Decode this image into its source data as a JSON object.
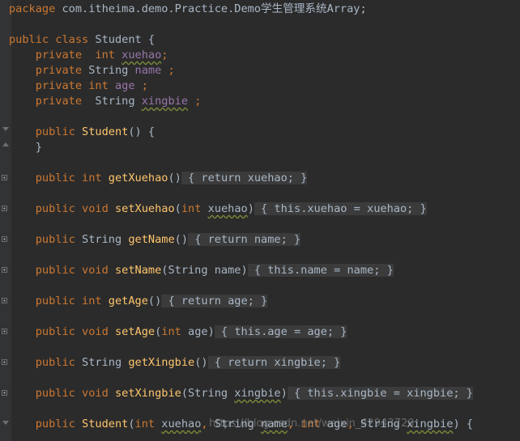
{
  "code_lines": [
    {
      "parts": [
        [
          "kw",
          "package"
        ],
        [
          "t",
          " com.itheima.demo.Practice.Demo学生管理系统Array;"
        ]
      ]
    },
    {
      "parts": []
    },
    {
      "parts": [
        [
          "kw",
          "public class"
        ],
        [
          "t",
          " Student {"
        ]
      ]
    },
    {
      "parts": [
        [
          "t",
          "    "
        ],
        [
          "kw",
          "private"
        ],
        [
          "t",
          "  "
        ],
        [
          "kw",
          "int"
        ],
        [
          "t",
          " "
        ],
        [
          "fldsq",
          "xuehao"
        ],
        [
          "kw",
          ";"
        ]
      ]
    },
    {
      "parts": [
        [
          "t",
          "    "
        ],
        [
          "kw",
          "private"
        ],
        [
          "t",
          " String "
        ],
        [
          "fld",
          "name"
        ],
        [
          "t",
          " "
        ],
        [
          "kw",
          ";"
        ]
      ]
    },
    {
      "parts": [
        [
          "t",
          "    "
        ],
        [
          "kw",
          "private"
        ],
        [
          "t",
          " "
        ],
        [
          "kw",
          "int"
        ],
        [
          "t",
          " "
        ],
        [
          "fld",
          "age"
        ],
        [
          "t",
          " "
        ],
        [
          "kw",
          ";"
        ]
      ]
    },
    {
      "parts": [
        [
          "t",
          "    "
        ],
        [
          "kw",
          "private"
        ],
        [
          "t",
          "  String "
        ],
        [
          "fldsq",
          "xingbie"
        ],
        [
          "t",
          " "
        ],
        [
          "kw",
          ";"
        ]
      ]
    },
    {
      "parts": []
    },
    {
      "parts": [
        [
          "t",
          "    "
        ],
        [
          "kw",
          "public"
        ],
        [
          "t",
          " "
        ],
        [
          "fn",
          "Student"
        ],
        [
          "t",
          "() {"
        ]
      ]
    },
    {
      "parts": [
        [
          "t",
          "    }"
        ]
      ]
    },
    {
      "parts": []
    },
    {
      "parts": [
        [
          "t",
          "    "
        ],
        [
          "kw",
          "public int"
        ],
        [
          "t",
          " "
        ],
        [
          "fn",
          "getXuehao"
        ],
        [
          "t",
          "()"
        ],
        [
          "fb",
          " { "
        ],
        [
          "fbkw",
          "return"
        ],
        [
          "fb",
          " "
        ],
        [
          "fbfld",
          "xuehao"
        ],
        [
          "fbkw",
          ";"
        ],
        [
          "fb",
          " }"
        ]
      ]
    },
    {
      "parts": []
    },
    {
      "parts": [
        [
          "t",
          "    "
        ],
        [
          "kw",
          "public void"
        ],
        [
          "t",
          " "
        ],
        [
          "fn",
          "setXuehao"
        ],
        [
          "t",
          "("
        ],
        [
          "kw",
          "int"
        ],
        [
          "t",
          " "
        ],
        [
          "sq",
          "xuehao"
        ],
        [
          "t",
          ")"
        ],
        [
          "fb",
          " { "
        ],
        [
          "fbkw",
          "this"
        ],
        [
          "fbkw",
          "."
        ],
        [
          "fbfld",
          "xuehao"
        ],
        [
          "fb",
          " = xuehao"
        ],
        [
          "fbkw",
          ";"
        ],
        [
          "fb",
          " }"
        ]
      ]
    },
    {
      "parts": []
    },
    {
      "parts": [
        [
          "t",
          "    "
        ],
        [
          "kw",
          "public"
        ],
        [
          "t",
          " String "
        ],
        [
          "fn",
          "getName"
        ],
        [
          "t",
          "()"
        ],
        [
          "fb",
          " { "
        ],
        [
          "fbkw",
          "return"
        ],
        [
          "fb",
          " "
        ],
        [
          "fbfld",
          "name"
        ],
        [
          "fbkw",
          ";"
        ],
        [
          "fb",
          " }"
        ]
      ]
    },
    {
      "parts": []
    },
    {
      "parts": [
        [
          "t",
          "    "
        ],
        [
          "kw",
          "public void"
        ],
        [
          "t",
          " "
        ],
        [
          "fn",
          "setName"
        ],
        [
          "t",
          "(String name)"
        ],
        [
          "fb",
          " { "
        ],
        [
          "fbkw",
          "this"
        ],
        [
          "fbkw",
          "."
        ],
        [
          "fbfld",
          "name"
        ],
        [
          "fb",
          " = name"
        ],
        [
          "fbkw",
          ";"
        ],
        [
          "fb",
          " }"
        ]
      ]
    },
    {
      "parts": []
    },
    {
      "parts": [
        [
          "t",
          "    "
        ],
        [
          "kw",
          "public int"
        ],
        [
          "t",
          " "
        ],
        [
          "fn",
          "getAge"
        ],
        [
          "t",
          "()"
        ],
        [
          "fb",
          " { "
        ],
        [
          "fbkw",
          "return"
        ],
        [
          "fb",
          " "
        ],
        [
          "fbfld",
          "age"
        ],
        [
          "fbkw",
          ";"
        ],
        [
          "fb",
          " }"
        ]
      ]
    },
    {
      "parts": []
    },
    {
      "parts": [
        [
          "t",
          "    "
        ],
        [
          "kw",
          "public void"
        ],
        [
          "t",
          " "
        ],
        [
          "fn",
          "setAge"
        ],
        [
          "t",
          "("
        ],
        [
          "kw",
          "int"
        ],
        [
          "t",
          " age)"
        ],
        [
          "fb",
          " { "
        ],
        [
          "fbkw",
          "this"
        ],
        [
          "fbkw",
          "."
        ],
        [
          "fbfld",
          "age"
        ],
        [
          "fb",
          " = age"
        ],
        [
          "fbkw",
          ";"
        ],
        [
          "fb",
          " }"
        ]
      ]
    },
    {
      "parts": []
    },
    {
      "parts": [
        [
          "t",
          "    "
        ],
        [
          "kw",
          "public"
        ],
        [
          "t",
          " String "
        ],
        [
          "fn",
          "getXingbie"
        ],
        [
          "t",
          "()"
        ],
        [
          "fb",
          " { "
        ],
        [
          "fbkw",
          "return"
        ],
        [
          "fb",
          " xingbie"
        ],
        [
          "fbkw",
          ";"
        ],
        [
          "fb",
          " }"
        ]
      ]
    },
    {
      "parts": []
    },
    {
      "parts": [
        [
          "t",
          "    "
        ],
        [
          "kw",
          "public void"
        ],
        [
          "t",
          " "
        ],
        [
          "fn",
          "setXingbie"
        ],
        [
          "t",
          "(String "
        ],
        [
          "sq",
          "xingbie"
        ],
        [
          "t",
          ")"
        ],
        [
          "fb",
          " { "
        ],
        [
          "fbkw",
          "this"
        ],
        [
          "fbkw",
          "."
        ],
        [
          "fbfld",
          "xingbie"
        ],
        [
          "fb",
          " = xingbie"
        ],
        [
          "fbkw",
          ";"
        ],
        [
          "fb",
          " }"
        ]
      ]
    },
    {
      "parts": []
    },
    {
      "parts": [
        [
          "t",
          "    "
        ],
        [
          "kw",
          "public"
        ],
        [
          "t",
          " "
        ],
        [
          "fn",
          "Student"
        ],
        [
          "t",
          "("
        ],
        [
          "kw",
          "int"
        ],
        [
          "t",
          " "
        ],
        [
          "sq",
          "xuehao"
        ],
        [
          "kw",
          ","
        ],
        [
          "t",
          " String "
        ],
        [
          "sq",
          "name"
        ],
        [
          "kw",
          ","
        ],
        [
          "t",
          " "
        ],
        [
          "kw",
          "int"
        ],
        [
          "t",
          " age"
        ],
        [
          "kw",
          ","
        ],
        [
          "t",
          " String "
        ],
        [
          "sq",
          "xingbie"
        ],
        [
          "t",
          ") {"
        ]
      ]
    }
  ],
  "watermark": "https://blog.csdn.net/weixin_42943720",
  "colors": {
    "background": "#2b2b2b",
    "keyword": "#cc7832",
    "method": "#ffc66d",
    "field": "#9876aa",
    "text": "#a9b7c6"
  }
}
